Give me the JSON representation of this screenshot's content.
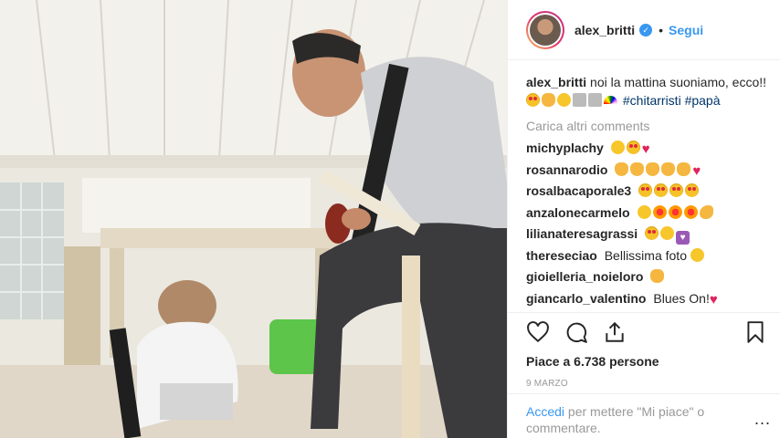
{
  "post": {
    "username": "alex_britti",
    "follow_label": "Segui",
    "dot": "•",
    "verified_mark": "✓",
    "caption_text": "noi la mattina suoniamo, ecco!!",
    "hashtags": "#chitarristi #papà",
    "load_more": "Carica altri comments",
    "comments": [
      {
        "user": "michyplachy",
        "text": ""
      },
      {
        "user": "rosannarodio",
        "text": ""
      },
      {
        "user": "rosalbacaporale3",
        "text": ""
      },
      {
        "user": "anzalonecarmelo",
        "text": ""
      },
      {
        "user": "lilianateresagrassi",
        "text": ""
      },
      {
        "user": "thereseciao",
        "text": "Bellissima foto"
      },
      {
        "user": "gioielleria_noieloro",
        "text": ""
      },
      {
        "user": "giancarlo_valentino",
        "text": "Blues On!"
      }
    ],
    "likes": "Piace a 6.738 persone",
    "date": "9 MARZO",
    "login_link": "Accedi",
    "login_text": "per mettere \"Mi piace\" o commentare.",
    "more": "..."
  },
  "icons": [
    "heart-icon",
    "comment-icon",
    "share-icon",
    "bookmark-icon"
  ],
  "colors": {
    "link": "#3897f0",
    "muted": "#999999",
    "text": "#262626",
    "hashtag": "#003569"
  }
}
